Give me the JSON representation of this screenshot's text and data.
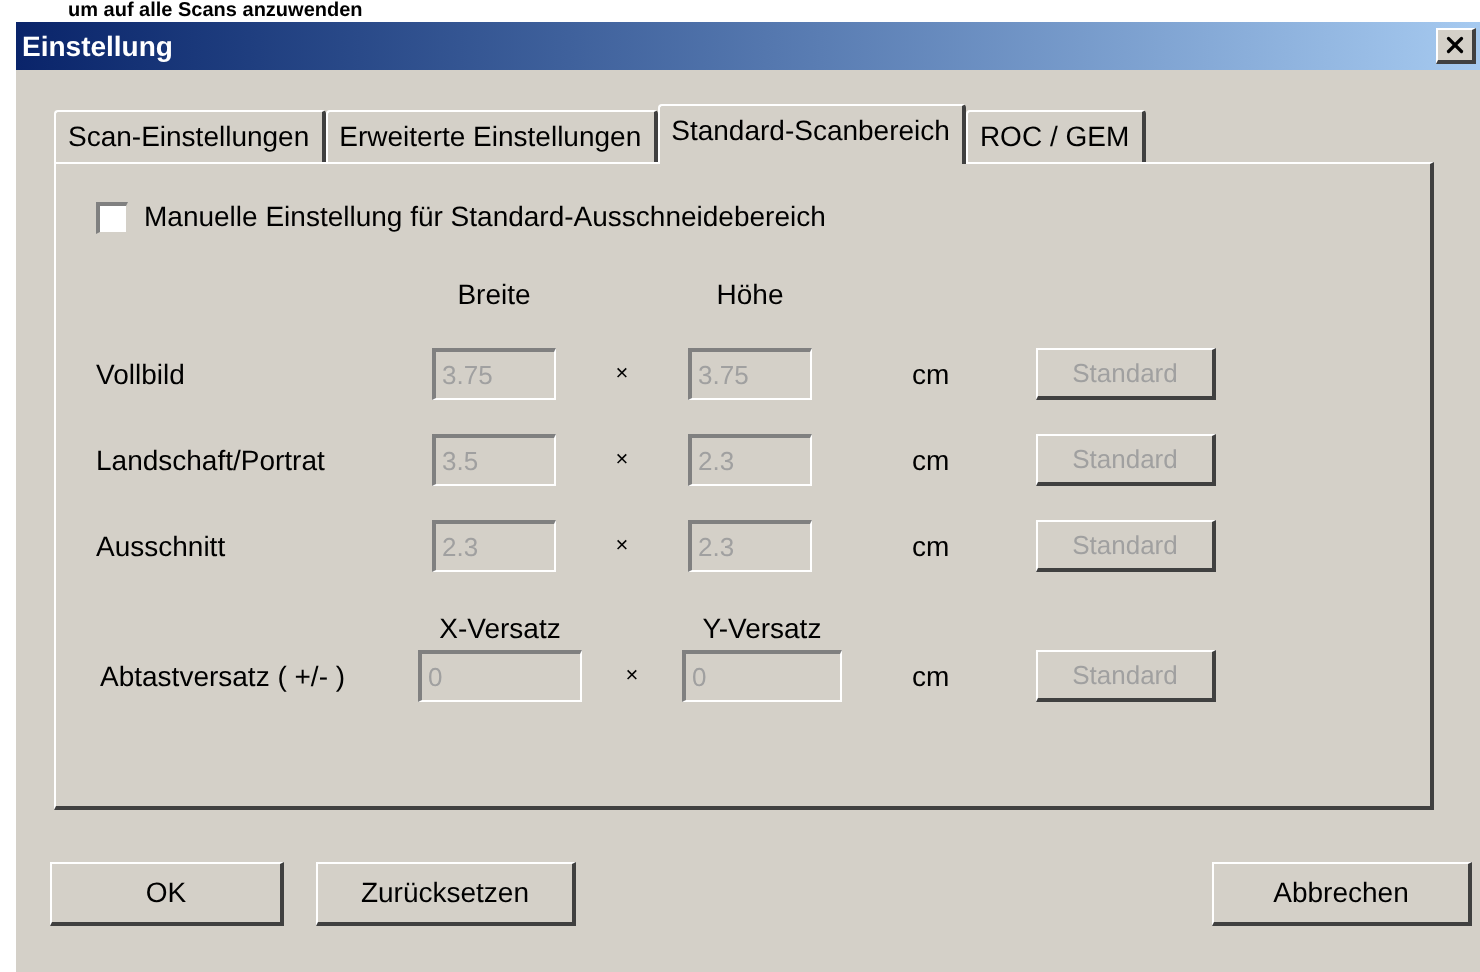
{
  "header_fragment": "um auf alle Scans anzuwenden",
  "window": {
    "title": "Einstellung"
  },
  "tabs": [
    {
      "label": "Scan-Einstellungen",
      "selected": false
    },
    {
      "label": "Erweiterte Einstellungen",
      "selected": false
    },
    {
      "label": "Standard-Scanbereich",
      "selected": true
    },
    {
      "label": "ROC / GEM",
      "selected": false
    }
  ],
  "manual_checkbox": {
    "label": "Manuelle Einstellung für Standard-Ausschneidebereich",
    "checked": false
  },
  "columns": [
    "Breite",
    "Höhe"
  ],
  "size_rows": [
    {
      "label": "Vollbild",
      "width": {
        "value": "3.75",
        "disabled": true
      },
      "separator": "×",
      "height": {
        "value": "3.75",
        "disabled": true
      },
      "unit": "cm",
      "button": {
        "label": "Standard",
        "disabled": true
      }
    },
    {
      "label": "Landschaft/Portrat",
      "width": {
        "value": "3.5",
        "disabled": true
      },
      "separator": "×",
      "height": {
        "value": "2.3",
        "disabled": true
      },
      "unit": "cm",
      "button": {
        "label": "Standard",
        "disabled": true
      }
    },
    {
      "label": "Ausschnitt",
      "width": {
        "value": "2.3",
        "disabled": true
      },
      "separator": "×",
      "height": {
        "value": "2.3",
        "disabled": true
      },
      "unit": "cm",
      "button": {
        "label": "Standard",
        "disabled": true
      }
    }
  ],
  "offset_row": {
    "label": "Abtastversatz ( +/- )",
    "x_label": "X-Versatz",
    "y_label": "Y-Versatz",
    "x": {
      "value": "0",
      "disabled": true
    },
    "separator": "×",
    "y": {
      "value": "0",
      "disabled": true
    },
    "unit": "cm",
    "button": {
      "label": "Standard",
      "disabled": true
    }
  },
  "buttons": [
    {
      "label": "OK"
    },
    {
      "label": "Zurücksetzen"
    },
    {
      "label": "Abbrechen"
    }
  ]
}
